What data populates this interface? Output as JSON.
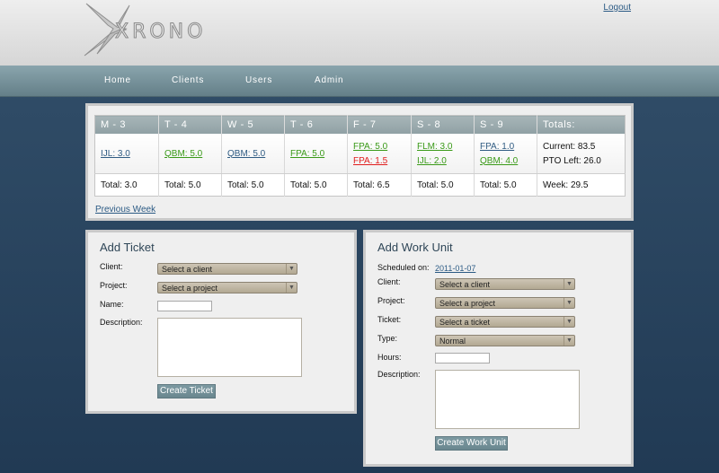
{
  "header": {
    "logo_text": "XRONO",
    "logout_label": "Logout"
  },
  "nav": {
    "items": [
      {
        "label": "Home"
      },
      {
        "label": "Clients"
      },
      {
        "label": "Users"
      },
      {
        "label": "Admin"
      }
    ]
  },
  "week": {
    "columns": [
      "M - 3",
      "T - 4",
      "W - 5",
      "T - 6",
      "F - 7",
      "S - 8",
      "S - 9",
      "Totals:"
    ],
    "entries": [
      [
        {
          "text": "IJL: 3.0",
          "color": "blue"
        }
      ],
      [
        {
          "text": "QBM: 5.0",
          "color": "green"
        }
      ],
      [
        {
          "text": "QBM: 5.0",
          "color": "blue"
        }
      ],
      [
        {
          "text": "FPA: 5.0",
          "color": "green"
        }
      ],
      [
        {
          "text": "FPA: 5.0",
          "color": "green"
        },
        {
          "text": "FPA: 1.5",
          "color": "red"
        }
      ],
      [
        {
          "text": "FLM: 3.0",
          "color": "green"
        },
        {
          "text": "IJL: 2.0",
          "color": "green"
        }
      ],
      [
        {
          "text": "FPA: 1.0",
          "color": "blue"
        },
        {
          "text": "QBM: 4.0",
          "color": "green"
        }
      ]
    ],
    "summary": {
      "current": "Current: 83.5",
      "pto_left": "PTO Left: 26.0"
    },
    "totals": [
      "Total: 3.0",
      "Total: 5.0",
      "Total: 5.0",
      "Total: 5.0",
      "Total: 6.5",
      "Total: 5.0",
      "Total: 5.0",
      "Week: 29.5"
    ],
    "previous_week_label": "Previous Week",
    "colors": {
      "blue": "#2f5b82",
      "green": "#3a9a18",
      "red": "#e01e1e"
    }
  },
  "add_ticket": {
    "title": "Add Ticket",
    "client_label": "Client:",
    "client_value": "Select a client",
    "project_label": "Project:",
    "project_value": "Select a project",
    "name_label": "Name:",
    "name_value": "",
    "description_label": "Description:",
    "description_value": "",
    "submit_label": "Create Ticket"
  },
  "add_work_unit": {
    "title": "Add Work Unit",
    "scheduled_label": "Scheduled on:",
    "scheduled_value": "2011-01-07",
    "client_label": "Client:",
    "client_value": "Select a client",
    "project_label": "Project:",
    "project_value": "Select a project",
    "ticket_label": "Ticket:",
    "ticket_value": "Select a ticket",
    "type_label": "Type:",
    "type_value": "Normal",
    "hours_label": "Hours:",
    "hours_value": "",
    "description_label": "Description:",
    "description_value": "",
    "submit_label": "Create Work Unit"
  },
  "icons": {
    "select_arrow": "chevron-down-icon"
  }
}
